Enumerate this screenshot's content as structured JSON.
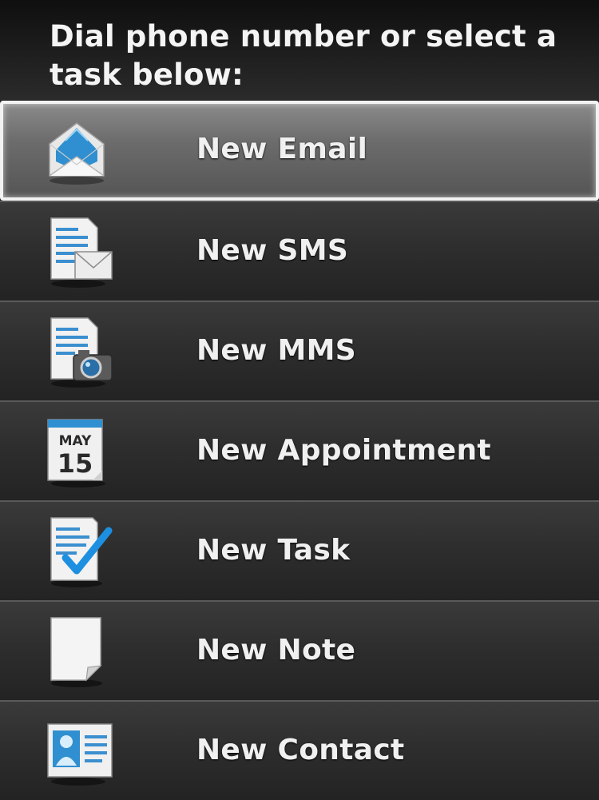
{
  "header": {
    "text": "Dial phone number or select a task below:"
  },
  "items": [
    {
      "label": "New Email",
      "icon": "email-icon",
      "selected": true
    },
    {
      "label": "New SMS",
      "icon": "sms-icon",
      "selected": false
    },
    {
      "label": "New MMS",
      "icon": "mms-icon",
      "selected": false
    },
    {
      "label": "New Appointment",
      "icon": "calendar-icon",
      "selected": false,
      "icon_text_month": "MAY",
      "icon_text_day": "15"
    },
    {
      "label": "New Task",
      "icon": "task-checkmark-icon",
      "selected": false
    },
    {
      "label": "New Note",
      "icon": "note-icon",
      "selected": false
    },
    {
      "label": "New Contact",
      "icon": "contact-card-icon",
      "selected": false
    }
  ],
  "colors": {
    "accent_blue": "#2f8fd0",
    "selected_border": "#f2f2f2",
    "text": "#f0f0f0"
  }
}
